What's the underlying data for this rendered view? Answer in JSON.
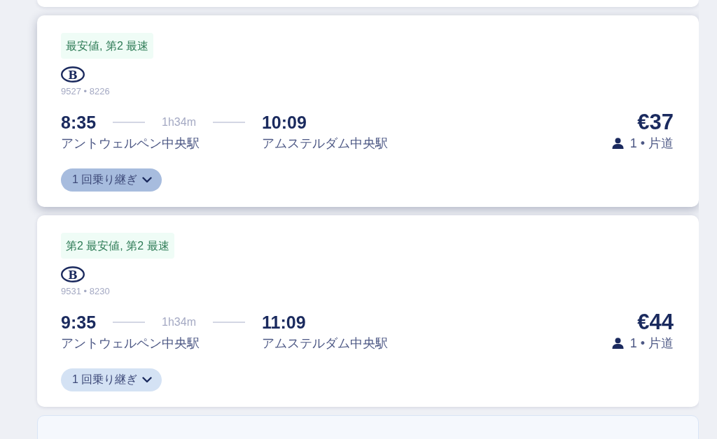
{
  "results": [
    {
      "tag": "最安値, 第2 最速",
      "logo_text": "B",
      "train_numbers": "9527 • 8226",
      "departure_time": "8:35",
      "duration": "1h34m",
      "arrival_time": "10:09",
      "price": "€37",
      "departure_station": "アントウェルペン中央駅",
      "arrival_station": "アムステルダム中央駅",
      "passengers": "1 • 片道",
      "stops": "1 回乗り継ぎ",
      "hovered": true
    },
    {
      "tag": "第2 最安値, 第2 最速",
      "logo_text": "B",
      "train_numbers": "9531 • 8230",
      "departure_time": "9:35",
      "duration": "1h34m",
      "arrival_time": "11:09",
      "price": "€44",
      "departure_station": "アントウェルペン中央駅",
      "arrival_station": "アムステルダム中央駅",
      "passengers": "1 • 片道",
      "stops": "1 回乗り継ぎ",
      "hovered": false
    }
  ]
}
